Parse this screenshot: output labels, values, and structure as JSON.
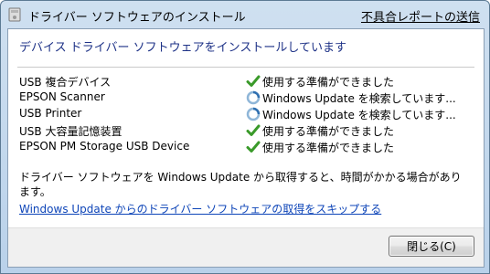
{
  "window": {
    "title": "ドライバー ソフトウェアのインストール",
    "report_link": "不具合レポートの送信"
  },
  "content": {
    "heading": "デバイス ドライバー ソフトウェアをインストールしています",
    "devices": [
      {
        "name": "USB 複合デバイス",
        "status": "使用する準備ができました",
        "icon": "check-icon"
      },
      {
        "name": "EPSON Scanner",
        "status": "Windows Update を検索しています...",
        "icon": "searching-icon"
      },
      {
        "name": "USB Printer",
        "status": "Windows Update を検索しています...",
        "icon": "searching-icon"
      },
      {
        "name": "USB 大容量記憶装置",
        "status": "使用する準備ができました",
        "icon": "check-icon"
      },
      {
        "name": "EPSON PM Storage USB Device",
        "status": "使用する準備ができました",
        "icon": "check-icon"
      }
    ],
    "note": "ドライバー ソフトウェアを Windows Update から取得すると、時間がかかる場合があります。",
    "skip_link": "Windows Update からのドライバー ソフトウェアの取得をスキップする"
  },
  "footer": {
    "close_label": "閉じる(C)"
  },
  "colors": {
    "heading": "#1e3287",
    "link": "#0e45b8",
    "check": "#3a9a2a"
  }
}
